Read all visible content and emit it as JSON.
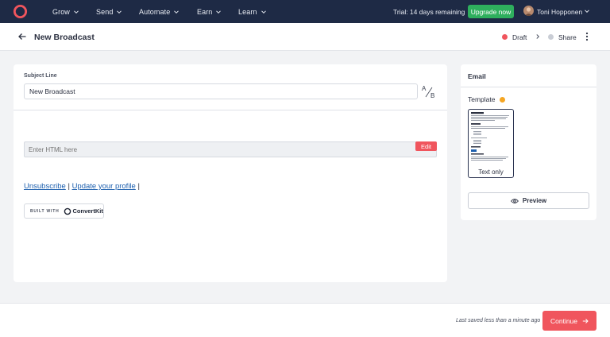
{
  "nav": {
    "items": [
      {
        "label": "Grow"
      },
      {
        "label": "Send"
      },
      {
        "label": "Automate"
      },
      {
        "label": "Earn"
      },
      {
        "label": "Learn"
      }
    ],
    "trial_text": "Trial: 14 days remaining",
    "upgrade_label": "Upgrade now",
    "user_name": "Toni Hopponen",
    "logo_icon": "convertkit-logo-icon"
  },
  "header": {
    "title": "New Broadcast",
    "steps": [
      {
        "label": "Draft",
        "color": "#f0555d"
      },
      {
        "label": "Share",
        "color": "#c9cdd5"
      }
    ]
  },
  "editor": {
    "subject_label": "Subject Line",
    "subject_value": "New Broadcast",
    "ab_a": "A",
    "ab_b": "B",
    "html_placeholder": "Enter HTML here",
    "edit_label": "Edit",
    "unsubscribe_label": "Unsubscribe",
    "separator": "|",
    "update_profile_label": "Update your profile",
    "built_with_label": "BUILT WITH",
    "brand_label": "ConvertKit"
  },
  "side": {
    "title": "Email",
    "template_label": "Template",
    "template_status_color": "#f5a623",
    "template_name": "Text only",
    "preview_label": "Preview"
  },
  "footer": {
    "saved_text": "Last saved less than a minute ago",
    "continue_label": "Continue"
  }
}
